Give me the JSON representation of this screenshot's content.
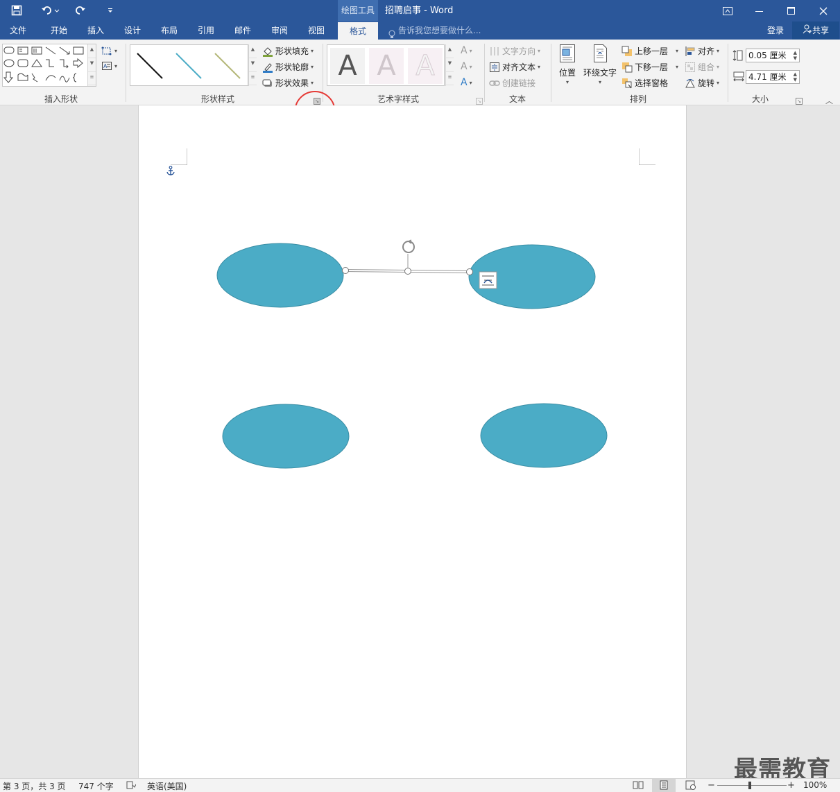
{
  "title_bar": {
    "context_tools_label": "绘图工具",
    "document_title": "招聘启事 - Word"
  },
  "tabs": [
    "文件",
    "开始",
    "插入",
    "设计",
    "布局",
    "引用",
    "邮件",
    "审阅",
    "视图",
    "格式"
  ],
  "active_tab": "格式",
  "tell_me": "告诉我您想要做什么...",
  "login": "登录",
  "share": "共享",
  "ribbon": {
    "groups": {
      "insert_shapes": "插入形状",
      "shape_styles": "形状样式",
      "wordart_styles": "艺术字样式",
      "text": "文本",
      "arrange": "排列",
      "size": "大小"
    },
    "shape_fill": "形状填充",
    "shape_outline": "形状轮廓",
    "shape_effects": "形状效果",
    "text_direction": "文字方向",
    "align_text": "对齐文本",
    "create_link": "创建链接",
    "position": "位置",
    "wrap_text": "环绕文字",
    "bring_forward": "上移一层",
    "send_backward": "下移一层",
    "selection_pane": "选择窗格",
    "align": "对齐",
    "group": "组合",
    "rotate": "旋转",
    "height_value": "0.05 厘米",
    "width_value": "4.71 厘米",
    "wordart_letter": "A"
  },
  "status_bar": {
    "page_info": "第 3 页，共 3 页",
    "word_count": "747 个字",
    "language": "英语(美国)",
    "zoom": "100%"
  },
  "watermark": "最需教育",
  "colors": {
    "title_blue": "#2b579a",
    "ellipse_fill": "#4bacc6",
    "highlight_circle": "#e53935"
  }
}
